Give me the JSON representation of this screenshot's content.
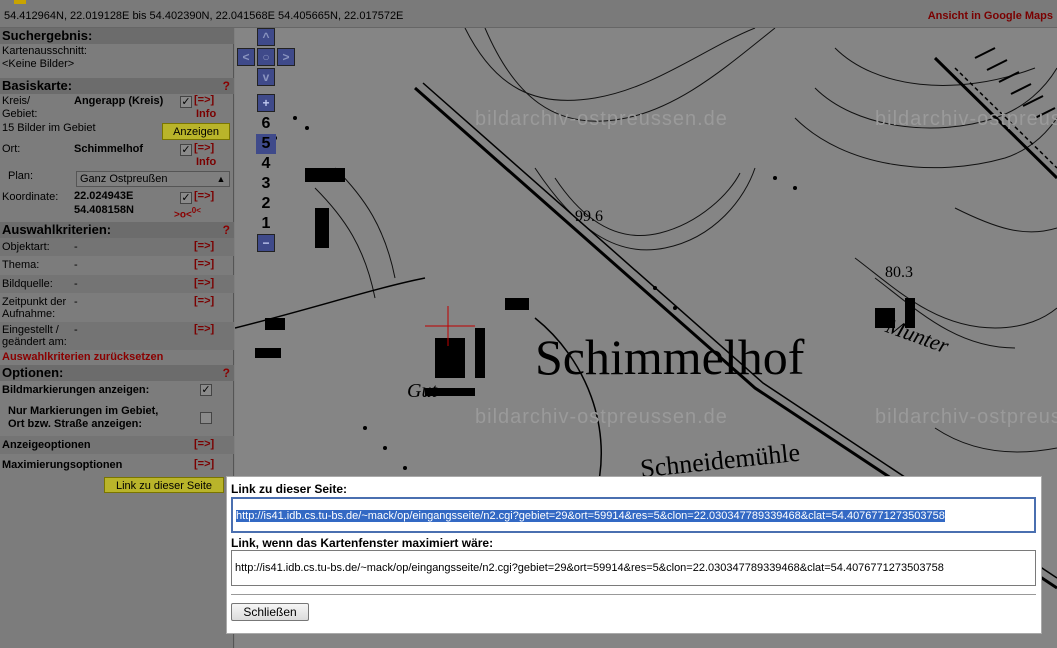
{
  "topbar": {
    "coords": "54.412964N, 22.019128E bis 54.402390N, 22.041568E   54.405665N, 22.017572E",
    "gmaps_link": "Ansicht in Google Maps"
  },
  "sidebar": {
    "suchergebnis": {
      "title": "Suchergebnis:",
      "kartenausschnitt_label": "Kartenausschnitt:",
      "keine_bilder": "<Keine Bilder>"
    },
    "basiskarte": {
      "title": "Basiskarte:",
      "help": "?",
      "kreis_label": "Kreis/",
      "gebiet_label": "Gebiet:",
      "kreis_value": "Angerapp (Kreis)",
      "arrow": "[=>]",
      "info": "Info",
      "bilder_count": "15 Bilder im Gebiet",
      "anzeigen": "Anzeigen",
      "ort_label": "Ort:",
      "ort_value": "Schimmelhof",
      "plan_label": "Plan:",
      "plan_value": "Ganz Ostpreußen",
      "koordinate_label": "Koordinate:",
      "koord_e": "22.024943E",
      "koord_n": "54.408158N",
      "center_marker": ">o<",
      "center_marker_sup": "0<"
    },
    "auswahl": {
      "title": "Auswahlkriterien:",
      "help": "?",
      "rows": [
        {
          "label": "Objektart:",
          "value": "-",
          "arrow": "[=>]"
        },
        {
          "label": "Thema:",
          "value": "-",
          "arrow": "[=>]"
        },
        {
          "label": "Bildquelle:",
          "value": "-",
          "arrow": "[=>]"
        },
        {
          "label": "Zeitpunkt der Aufnahme:",
          "value": "-",
          "arrow": "[=>]"
        },
        {
          "label": "Eingestellt / geändert am:",
          "value": "-",
          "arrow": "[=>]"
        }
      ],
      "reset": "Auswahlkriterien zurücksetzen"
    },
    "optionen": {
      "title": "Optionen:",
      "help": "?",
      "bildmarkierungen": "Bildmarkierungen anzeigen:",
      "nur_markierungen_1": "Nur Markierungen im Gebiet,",
      "nur_markierungen_2": "Ort bzw. Straße anzeigen:",
      "anzeigeoptionen": "Anzeigeoptionen",
      "maximierungsoptionen": "Maximierungsoptionen",
      "arrow": "[=>]",
      "link_button": "Link zu dieser Seite"
    }
  },
  "map": {
    "label_main": "Schimmelhof",
    "label_gut": "Gut",
    "label_schneidemuehle": "Schneidemühle",
    "label_munter": "Munter",
    "label_height1": "99.6",
    "label_height2": "80.3",
    "watermark": "bildarchiv-ostpreussen.de",
    "zoom_levels": [
      "+",
      "6",
      "5",
      "4",
      "3",
      "2",
      "1",
      "−"
    ],
    "current_zoom": "5"
  },
  "dialog": {
    "label1": "Link zu dieser Seite:",
    "url1": "http://is41.idb.cs.tu-bs.de/~mack/op/eingangsseite/n2.cgi?gebiet=29&ort=59914&res=5&clon=22.030347789339468&clat=54.4076771273503758",
    "label2": "Link, wenn das Kartenfenster maximiert wäre:",
    "url2": "http://is41.idb.cs.tu-bs.de/~mack/op/eingangsseite/n2.cgi?gebiet=29&ort=59914&res=5&clon=22.030347789339468&clat=54.4076771273503758",
    "close": "Schließen"
  }
}
